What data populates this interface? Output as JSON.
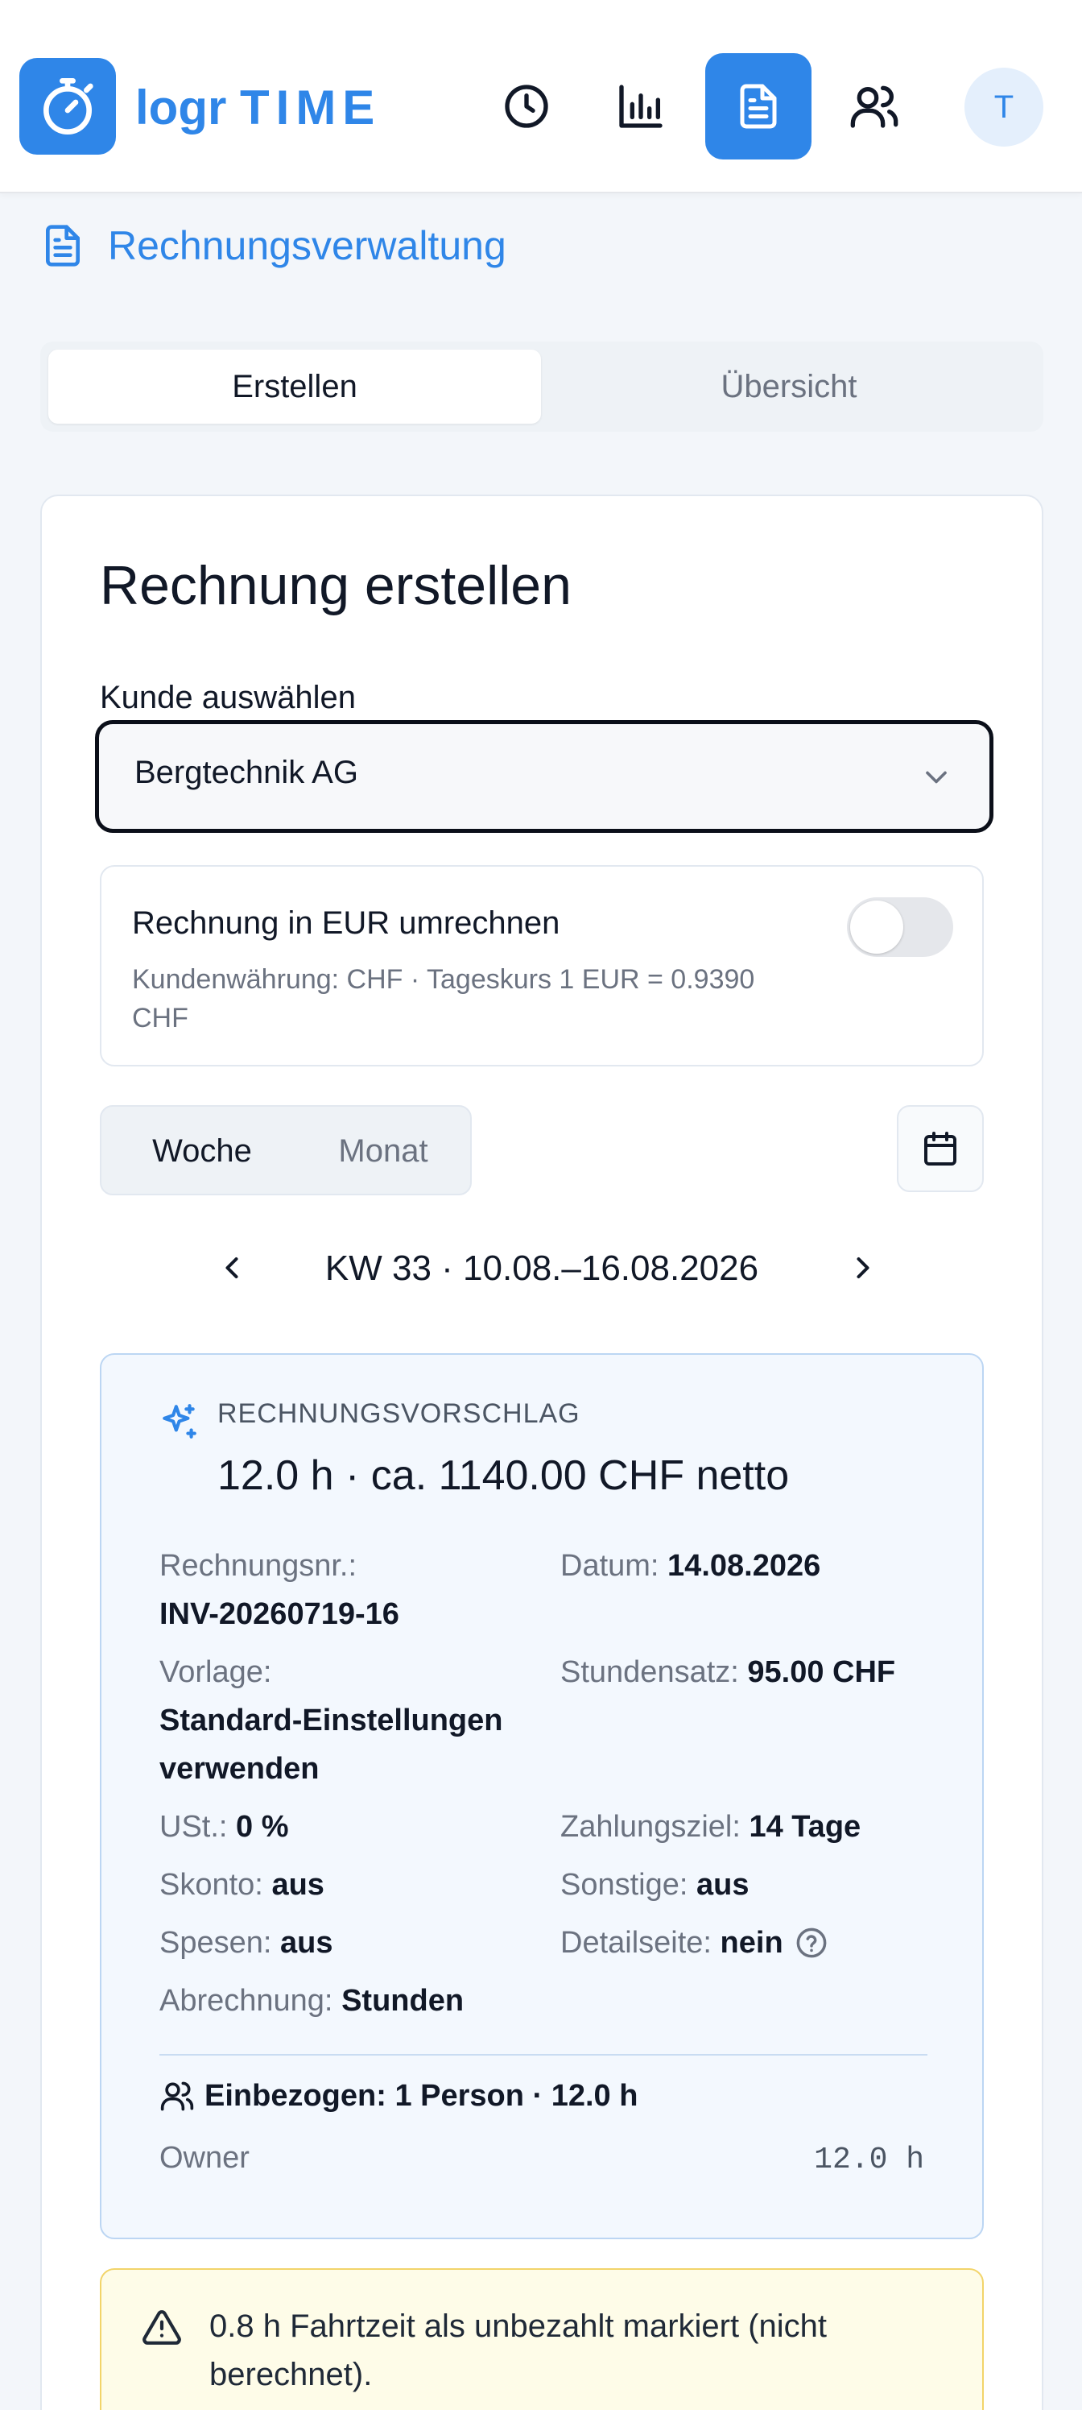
{
  "app": {
    "logo_text_a": "logr",
    "logo_text_b": "TIME",
    "avatar_initial": "T"
  },
  "nav": {
    "items": [
      {
        "icon": "clock-icon"
      },
      {
        "icon": "bar-chart-icon"
      },
      {
        "icon": "document-icon",
        "active": true
      },
      {
        "icon": "users-icon"
      }
    ]
  },
  "page": {
    "title": "Rechnungsverwaltung"
  },
  "tabs": {
    "create": "Erstellen",
    "overview": "Übersicht"
  },
  "form": {
    "title": "Rechnung erstellen",
    "customer_label": "Kunde auswählen",
    "customer_value": "Bergtechnik AG",
    "convert_title": "Rechnung in EUR umrechnen",
    "convert_sub": "Kundenwährung: CHF · Tageskurs 1 EUR = 0.9390 CHF",
    "convert_enabled": false,
    "period_week": "Woche",
    "period_month": "Monat",
    "week_label": "KW 33 · 10.08.–16.08.2026"
  },
  "suggestion": {
    "kicker": "RECHNUNGSVORSCHLAG",
    "headline": "12.0 h · ca. 1140.00 CHF netto",
    "invoice_no_label": "Rechnungsnr.:",
    "invoice_no_value": "INV-20260719-16",
    "date_label": "Datum:",
    "date_value": "14.08.2026",
    "template_label": "Vorlage:",
    "template_value": "Standard-Einstellungen verwenden",
    "rate_label": "Stundensatz:",
    "rate_value": "95.00 CHF",
    "vat_label": "USt.:",
    "vat_value": "0 %",
    "terms_label": "Zahlungsziel:",
    "terms_value": "14 Tage",
    "discount_label": "Skonto:",
    "discount_value": "aus",
    "other_label": "Sonstige:",
    "other_value": "aus",
    "expenses_label": "Spesen:",
    "expenses_value": "aus",
    "detail_label": "Detailseite:",
    "detail_value": "nein",
    "billing_label": "Abrechnung:",
    "billing_value": "Stunden",
    "included": "Einbezogen: 1 Person · 12.0 h",
    "person_name": "Owner",
    "person_hours": "12.0 h"
  },
  "warning": {
    "text": "0.8 h Fahrtzeit als unbezahlt markiert (nicht berechnet)."
  },
  "colors": {
    "accent": "#2f86e8",
    "suggestion_bg": "#f3f8fe",
    "warning_bg": "#fefce8",
    "warning_border": "#f2d46a"
  }
}
